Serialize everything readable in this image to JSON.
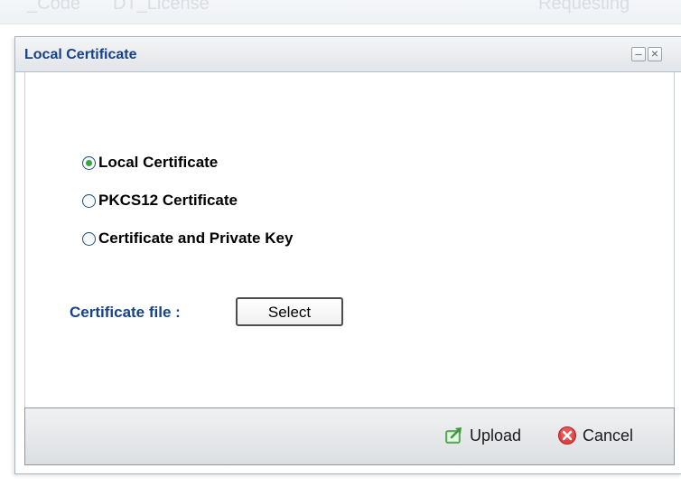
{
  "background": {
    "header_fragments": [
      "_Code",
      "DT_License",
      "Requesting"
    ]
  },
  "dialog": {
    "title": "Local Certificate",
    "minimize_symbol": "–",
    "close_symbol": "×",
    "options": [
      {
        "label": "Local Certificate",
        "selected": true
      },
      {
        "label": "PKCS12 Certificate",
        "selected": false
      },
      {
        "label": "Certificate and Private Key",
        "selected": false
      }
    ],
    "certificate_file_label": "Certificate file :",
    "select_button": "Select",
    "footer": {
      "upload_label": "Upload",
      "cancel_label": "Cancel"
    }
  },
  "colors": {
    "title_text": "#15428b",
    "radio_selected": "#3ba63b",
    "upload_icon": "#3c9a3c",
    "cancel_icon": "#e04040"
  },
  "icons": [
    "minimize-icon",
    "close-icon",
    "upload-icon",
    "cancel-icon"
  ]
}
